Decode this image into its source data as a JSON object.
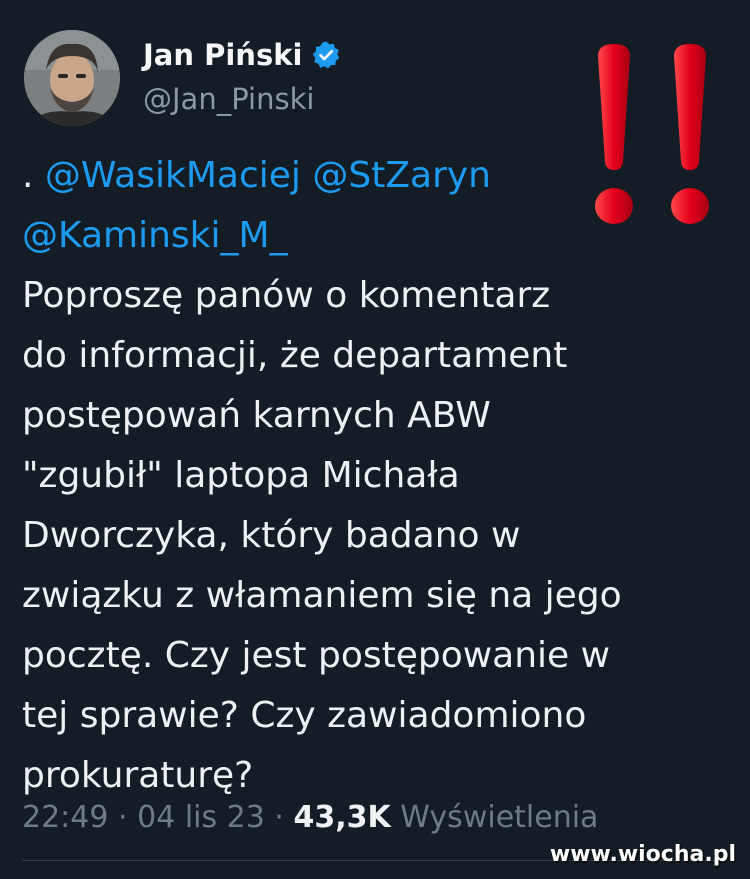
{
  "author": {
    "name": "Jan Piński",
    "handle": "@Jan_Pinski",
    "verified": true
  },
  "tweet": {
    "prefix": ". ",
    "mention_1": "@WasikMaciej",
    "mention_2": "@StZaryn",
    "mention_3": "@Kaminski_M_",
    "lines": [
      "Poproszę panów o komentarz",
      "do informacji, że departament",
      "postępowań karnych ABW",
      "\"zgubił\" laptopa Michała",
      "Dworczyka, który badano w",
      "związku z włamaniem się na jego",
      "pocztę. Czy jest postępowanie w",
      "tej sprawie? Czy zawiadomiono",
      "prokuraturę?"
    ]
  },
  "meta": {
    "time": "22:49",
    "date": "04 lis 23",
    "separator": "·",
    "views_count": "43,3K",
    "views_label": "Wyświetlenia"
  },
  "watermark": "www.wiocha.pl",
  "colors": {
    "background": "#141d26",
    "mention": "#1d9bf0",
    "verified_badge": "#1d9bf0",
    "exclamation": "#e3001b",
    "secondary_text": "#6e7a85"
  },
  "icons": {
    "verified": "verified-badge-icon",
    "alert": "double-exclamation-icon"
  }
}
